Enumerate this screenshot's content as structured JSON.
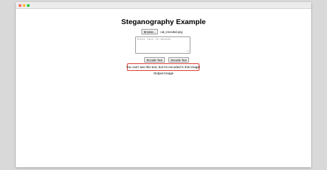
{
  "window": {
    "controls": [
      {
        "name": "close",
        "color": "#ff5f57"
      },
      {
        "name": "minimize",
        "color": "#febc2e"
      },
      {
        "name": "maximize",
        "color": "#28c840"
      }
    ]
  },
  "page": {
    "title": "Steganography Example"
  },
  "file_input": {
    "button_label": "Browse...",
    "file_name": "cat_encoded.png"
  },
  "text_input": {
    "placeholder": "Enter text to encode",
    "value": ""
  },
  "actions": {
    "encode_label": "Encode Text",
    "decode_label": "Decode Text"
  },
  "output": {
    "decoded_text": "You can't see this text, but it's encoded in this image!",
    "highlight_color": "#d9352a",
    "image_label": "Output Image"
  }
}
